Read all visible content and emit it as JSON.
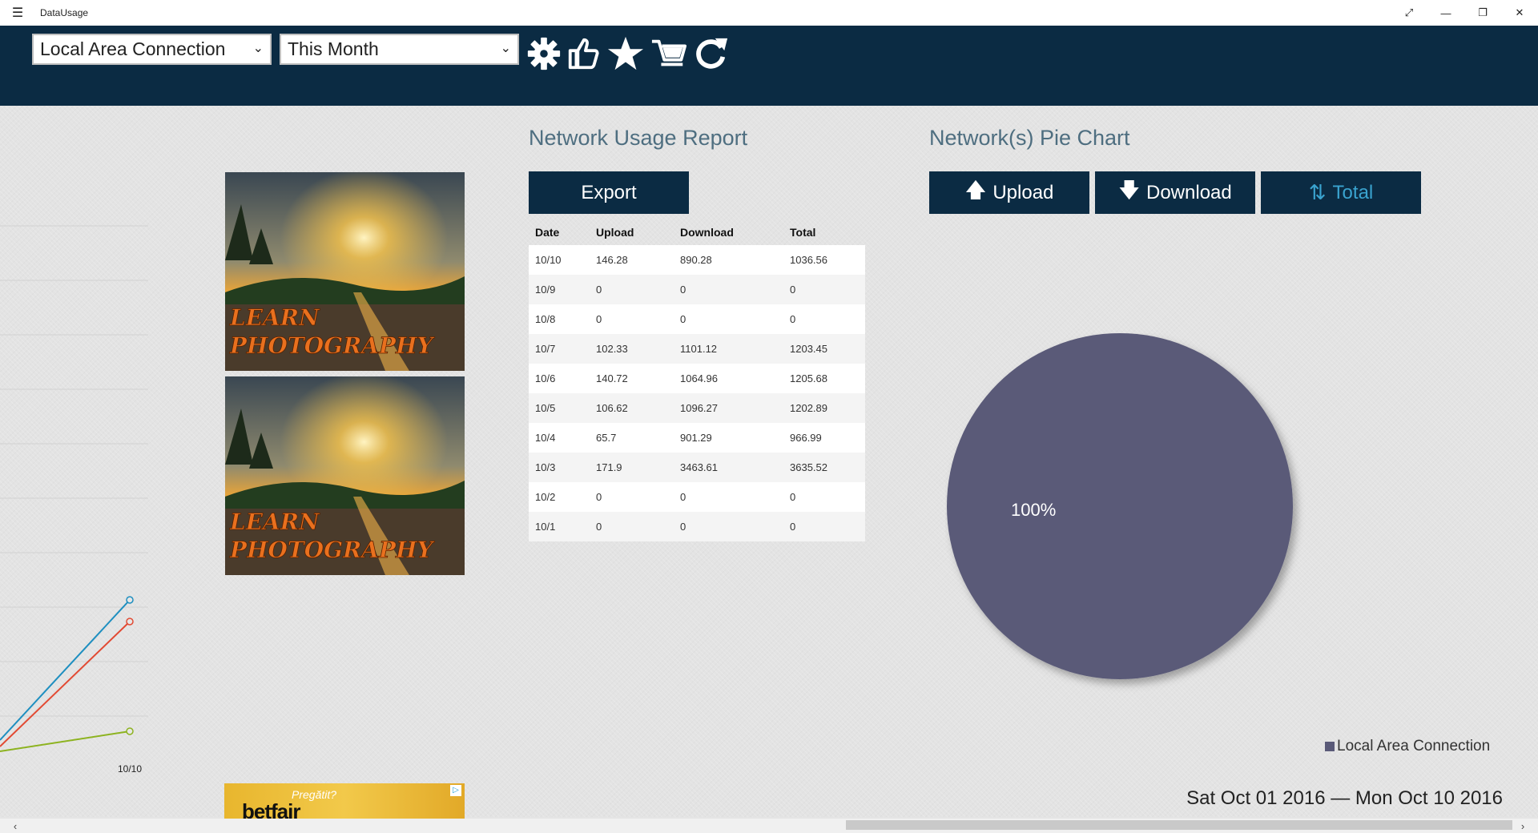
{
  "window": {
    "title": "DataUsage",
    "menu_icon": "hamburger-icon",
    "controls": [
      "expand-icon",
      "minimize-icon",
      "restore-icon",
      "close-icon"
    ]
  },
  "toolbar": {
    "connection_select": {
      "value": "Local Area Connection"
    },
    "period_select": {
      "value": "This Month"
    },
    "icons": [
      "settings-icon",
      "thumbs-up-icon",
      "star-icon",
      "cart-icon",
      "refresh-icon"
    ],
    "background_color": "#0b2b43"
  },
  "line_chart": {
    "x_tick_label": "10/10",
    "series_colors": [
      "#1e8fc0",
      "#e24a33",
      "#8db320"
    ]
  },
  "ads": {
    "photo_text_line1": "LEARN",
    "photo_text_line2": "PHOTOGRAPHY",
    "bottom_tagline": "Pregătit?",
    "bottom_brand": "betfair"
  },
  "report": {
    "title": "Network Usage Report",
    "export_label": "Export",
    "columns": [
      "Date",
      "Upload",
      "Download",
      "Total"
    ],
    "rows": [
      [
        "10/10",
        "146.28",
        "890.28",
        "1036.56"
      ],
      [
        "10/9",
        "0",
        "0",
        "0"
      ],
      [
        "10/8",
        "0",
        "0",
        "0"
      ],
      [
        "10/7",
        "102.33",
        "1101.12",
        "1203.45"
      ],
      [
        "10/6",
        "140.72",
        "1064.96",
        "1205.68"
      ],
      [
        "10/5",
        "106.62",
        "1096.27",
        "1202.89"
      ],
      [
        "10/4",
        "65.7",
        "901.29",
        "966.99"
      ],
      [
        "10/3",
        "171.9",
        "3463.61",
        "3635.52"
      ],
      [
        "10/2",
        "0",
        "0",
        "0"
      ],
      [
        "10/1",
        "0",
        "0",
        "0"
      ]
    ]
  },
  "pie_section": {
    "title": "Network(s) Pie Chart",
    "buttons": {
      "upload": "Upload",
      "download": "Download",
      "total": "Total",
      "active": "total"
    }
  },
  "chart_data": {
    "type": "pie",
    "series": [
      {
        "name": "Local Area Connection",
        "value": 100,
        "label": "100%",
        "color": "#5a5a78"
      }
    ],
    "legend_position": "bottom-right"
  },
  "date_range": "Sat Oct 01 2016 — Mon Oct 10 2016"
}
